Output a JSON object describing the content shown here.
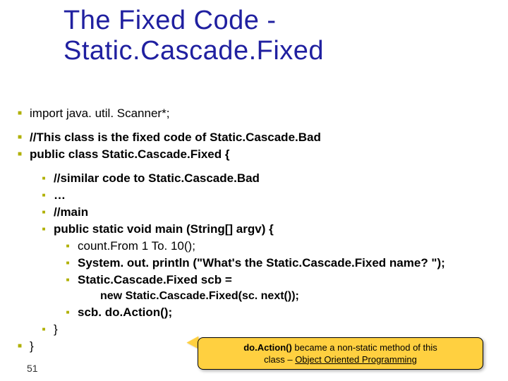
{
  "title_line1": "The Fixed Code -",
  "title_line2": "Static.Cascade.Fixed",
  "code": {
    "import": "import java. util. Scanner*;",
    "comment_class": "//This class is the fixed code of Static.Cascade.Bad",
    "class_decl": "public class Static.Cascade.Fixed {",
    "comment_similar": "//similar code to Static.Cascade.Bad",
    "ellipsis": "…",
    "comment_main": "//main",
    "main_sig": "public static void main (String[] argv) {",
    "call_count": "count.From 1 To. 10();",
    "println": "System. out. println (\"What's the Static.Cascade.Fixed name? \");",
    "decl_scb": "Static.Cascade.Fixed scb =",
    "new_scb": "new Static.Cascade.Fixed(sc. next());",
    "do_action": "scb. do.Action();",
    "close_main": "}",
    "close_class": "}"
  },
  "callout": {
    "bold": "do.Action()",
    "rest1": " became a non-static method of this",
    "rest2": "class – ",
    "u": "Object Oriented Programming"
  },
  "page": "51"
}
